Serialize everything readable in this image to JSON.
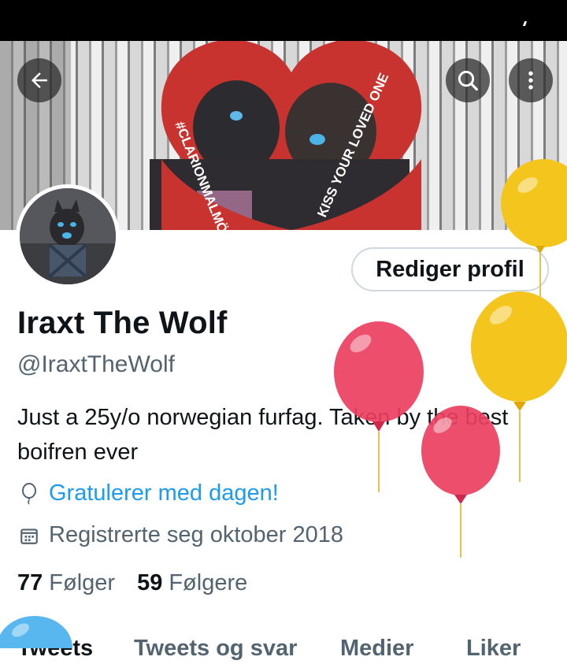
{
  "banner": {
    "heart_left_text": "#CLARIONMALMÖLIVE",
    "heart_right_text": "KISS YOUR LOVED ONE"
  },
  "nav": {
    "back_icon": "arrow-left-icon",
    "search_icon": "search-icon",
    "more_icon": "more-vertical-icon"
  },
  "profile": {
    "name": "Iraxt The Wolf",
    "handle": "@IraxtTheWolf",
    "bio": "Just a 25y/o norwegian furfag. Taken by the best boifren ever",
    "birthday_text": "Gratulerer med dagen!",
    "joined_text": "Registrerte seg oktober 2018",
    "edit_button": "Rediger profil"
  },
  "stats": {
    "following_count": "77",
    "following_label": "Følger",
    "followers_count": "59",
    "followers_label": "Følgere"
  },
  "tabs": [
    "Tweets",
    "Tweets og svar",
    "Medier",
    "Liker"
  ],
  "colors": {
    "link": "#1d9bf0",
    "heart": "#c8332f",
    "balloon_yellow": "#f4c51c",
    "balloon_pink": "#ea3f5f",
    "balloon_blue": "#58b7ef"
  }
}
